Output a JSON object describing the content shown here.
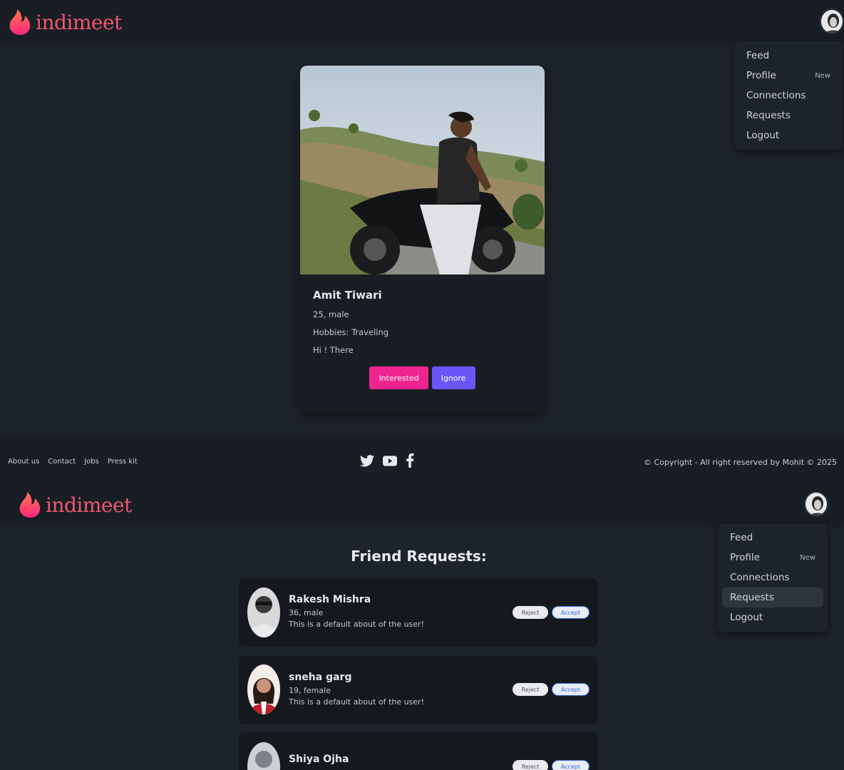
{
  "brand": {
    "name": "indimeet"
  },
  "menu": {
    "items": [
      {
        "label": "Feed",
        "badge": ""
      },
      {
        "label": "Profile",
        "badge": "New"
      },
      {
        "label": "Connections",
        "badge": ""
      },
      {
        "label": "Requests",
        "badge": ""
      },
      {
        "label": "Logout",
        "badge": ""
      }
    ],
    "active_second_screen": "Requests"
  },
  "feed_card": {
    "name": "Amit Tiwari",
    "age_gender": "25, male",
    "hobbies": "Hobbies: Traveling",
    "about": "Hi ! There",
    "interested_label": "Interested",
    "ignore_label": "Ignore"
  },
  "footer": {
    "links": [
      "About us",
      "Contact",
      "Jobs",
      "Press kit"
    ],
    "social_icons": [
      "twitter-icon",
      "youtube-icon",
      "facebook-icon"
    ],
    "copyright": "© Copyright - All right reserved by Mohit © 2025"
  },
  "requests": {
    "title": "Friend Requests:",
    "reject_label": "Reject",
    "accept_label": "Accept",
    "items": [
      {
        "name": "Rakesh Mishra",
        "age_gender": "36, male",
        "about": "This is a default about of the user!"
      },
      {
        "name": "sneha garg",
        "age_gender": "19, female",
        "about": "This is a default about of the user!"
      },
      {
        "name": "Shiya Ojha",
        "age_gender": "",
        "about": ""
      }
    ]
  },
  "colors": {
    "brand": "#f0566e",
    "interested": "#f0248f",
    "ignore": "#6a56f6",
    "accept": "#3c6be0"
  }
}
